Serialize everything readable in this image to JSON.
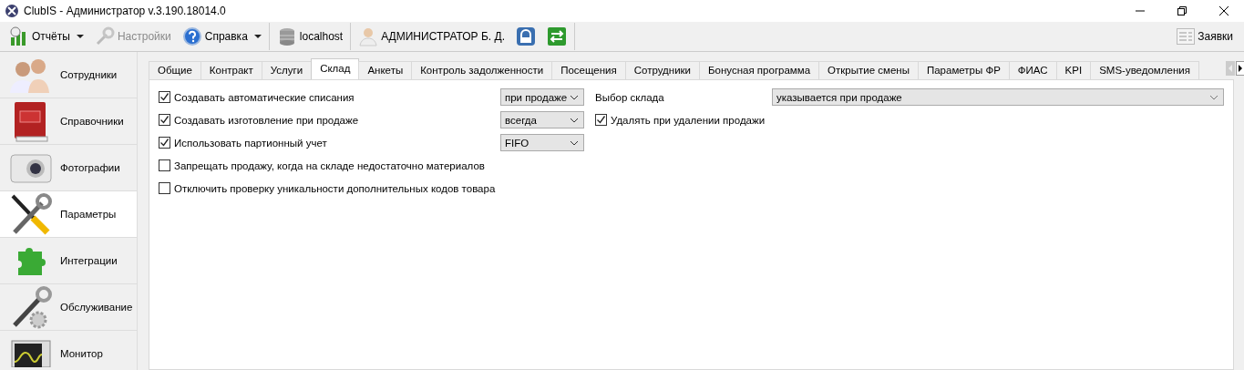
{
  "window": {
    "title": "ClubIS - Администратор v.3.190.18014.0"
  },
  "toolbar": {
    "items": [
      {
        "kind": "reports",
        "label": "Отчёты",
        "disabled": false,
        "dropdown": true
      },
      {
        "kind": "settings",
        "label": "Настройки",
        "disabled": true
      },
      {
        "kind": "help",
        "label": "Справка",
        "disabled": false,
        "dropdown": true
      },
      {
        "kind": "server",
        "label": "localhost",
        "disabled": false
      },
      {
        "kind": "user",
        "label": "АДМИНИСТРАТОР Б. Д.",
        "disabled": false
      },
      {
        "kind": "lock",
        "disabled": false
      },
      {
        "kind": "exchange",
        "disabled": false
      }
    ],
    "right": {
      "label": "Заявки"
    }
  },
  "sidebar": {
    "items": [
      {
        "kind": "people",
        "label": "Сотрудники",
        "selected": false
      },
      {
        "kind": "book",
        "label": "Справочники",
        "selected": false
      },
      {
        "kind": "camera",
        "label": "Фотографии",
        "selected": false
      },
      {
        "kind": "tools",
        "label": "Параметры",
        "selected": true
      },
      {
        "kind": "puzzle",
        "label": "Интеграции",
        "selected": false
      },
      {
        "kind": "service",
        "label": "Обслуживание",
        "selected": false
      },
      {
        "kind": "monitor",
        "label": "Монитор",
        "selected": false
      }
    ]
  },
  "tabs": [
    {
      "label": "Общие",
      "selected": false
    },
    {
      "label": "Контракт",
      "selected": false
    },
    {
      "label": "Услуги",
      "selected": false
    },
    {
      "label": "Склад",
      "selected": true
    },
    {
      "label": "Анкеты",
      "selected": false
    },
    {
      "label": "Контроль задолженности",
      "selected": false
    },
    {
      "label": "Посещения",
      "selected": false
    },
    {
      "label": "Сотрудники",
      "selected": false
    },
    {
      "label": "Бонусная программа",
      "selected": false
    },
    {
      "label": "Открытие смены",
      "selected": false
    },
    {
      "label": "Параметры ФР",
      "selected": false
    },
    {
      "label": "ФИАС",
      "selected": false
    },
    {
      "label": "KPI",
      "selected": false
    },
    {
      "label": "SMS-уведомления",
      "selected": false
    }
  ],
  "settings": [
    {
      "label": "Создавать автоматические списания",
      "checked": true,
      "select": "при продаже",
      "extra": {
        "kind": "select",
        "label": "Выбор склада",
        "value": "указывается при продаже"
      }
    },
    {
      "label": "Создавать изготовление при продаже",
      "checked": true,
      "select": "всегда",
      "extra": {
        "kind": "checkbox",
        "label": "Удалять при удалении продажи",
        "checked": true
      }
    },
    {
      "label": "Использовать партионный учет",
      "checked": true,
      "select": "FIFO"
    },
    {
      "label": "Запрещать продажу, когда на складе недостаточно материалов",
      "checked": false
    },
    {
      "label": "Отключить проверку уникальности дополнительных кодов товара",
      "checked": false
    }
  ]
}
